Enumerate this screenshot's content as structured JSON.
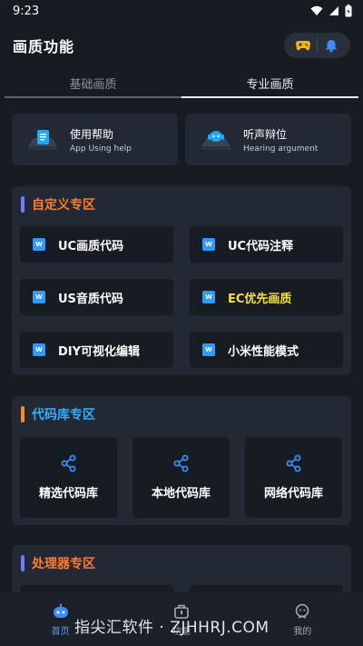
{
  "status": {
    "time": "9:23"
  },
  "header": {
    "title": "画质功能"
  },
  "tabs": [
    {
      "label": "基础画质",
      "active": false
    },
    {
      "label": "专业画质",
      "active": true
    }
  ],
  "help": [
    {
      "title": "使用帮助",
      "subtitle": "App Using help"
    },
    {
      "title": "听声辩位",
      "subtitle": "Hearing argument"
    }
  ],
  "sections": {
    "custom": {
      "title": "自定义专区",
      "title_color": "#ff7a2e",
      "bar_color": "#6f7cff",
      "items": [
        "UC画质代码",
        "UC代码注释",
        "US音质代码",
        "EC优先画质",
        "DIY可视化编辑",
        "小米性能模式"
      ],
      "highlight_color": "#f5e23b"
    },
    "library": {
      "title": "代码库专区",
      "title_color": "#2eb0ff",
      "bar_color": "#ff8a1f",
      "items": [
        "精选代码库",
        "本地代码库",
        "网络代码库"
      ]
    },
    "processor": {
      "title": "处理器专区",
      "title_color": "#ff7a2e",
      "bar_color": "#6f7cff"
    }
  },
  "nav": [
    {
      "label": "首页",
      "icon": "home-robot-icon",
      "active": true
    },
    {
      "label": "功能",
      "icon": "toolbox-icon",
      "active": false
    },
    {
      "label": "我的",
      "icon": "profile-icon",
      "active": false
    }
  ],
  "watermark": "指尖汇软件 · ZJHHRJ.COM"
}
